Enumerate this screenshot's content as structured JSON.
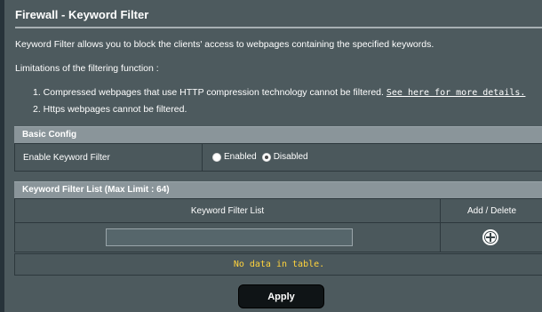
{
  "page": {
    "title": "Firewall - Keyword Filter",
    "description": "Keyword Filter allows you to block the clients' access to webpages containing the specified keywords.",
    "limitations_heading": "Limitations of the filtering function :",
    "limitations": [
      {
        "text": "1. Compressed webpages that use HTTP compression technology cannot be filtered.",
        "link": "See here for more details."
      },
      {
        "text": "2. Https webpages cannot be filtered."
      }
    ]
  },
  "basic_config": {
    "header": "Basic Config",
    "enable_label": "Enable Keyword Filter",
    "options": [
      {
        "label": "Enabled",
        "checked": false
      },
      {
        "label": "Disabled",
        "checked": true
      }
    ]
  },
  "keyword_list": {
    "header": "Keyword Filter List (Max Limit : 64)",
    "columns": [
      "Keyword Filter List",
      "Add / Delete"
    ],
    "input_value": "",
    "add_icon": "plus-circle-icon",
    "empty_message": "No data in table."
  },
  "actions": {
    "apply_label": "Apply"
  },
  "colors": {
    "background": "#4d5a5e",
    "section_header": "#8a959a",
    "empty_text": "#ffd33d",
    "apply_button": "#0f1416"
  }
}
